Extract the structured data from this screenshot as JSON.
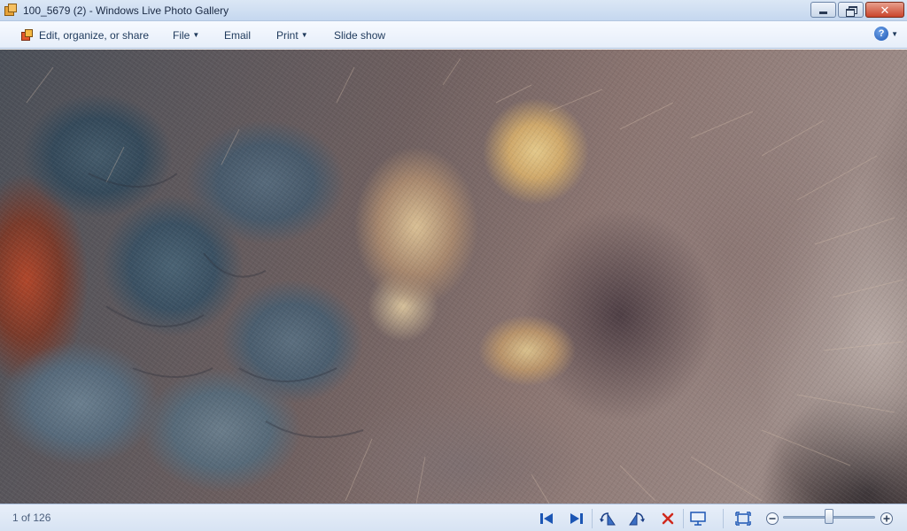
{
  "window": {
    "title": "100_5679 (2) - Windows Live Photo Gallery",
    "icon": "photo-gallery-icon"
  },
  "toolbar": {
    "items": [
      {
        "label": "Edit, organize, or share",
        "icon": "edit-organize-icon"
      },
      {
        "label": "File",
        "has_menu": true
      },
      {
        "label": "Email"
      },
      {
        "label": "Print",
        "has_menu": true
      },
      {
        "label": "Slide show"
      }
    ],
    "help_icon": "help-icon",
    "help_glyph": "?"
  },
  "photo": {
    "subject": "Close-up of a hairy spider's underside"
  },
  "status": {
    "position": "1 of 126"
  },
  "controls": {
    "icons": [
      "previous-icon",
      "next-icon",
      "rotate-left-icon",
      "rotate-right-icon",
      "delete-icon",
      "slideshow-icon",
      "actual-size-icon",
      "zoom-out-icon",
      "zoom-in-icon"
    ],
    "zoom_level": 0.5
  },
  "colors": {
    "accent_blue": "#1c56b4",
    "delete_red": "#d0281c"
  }
}
